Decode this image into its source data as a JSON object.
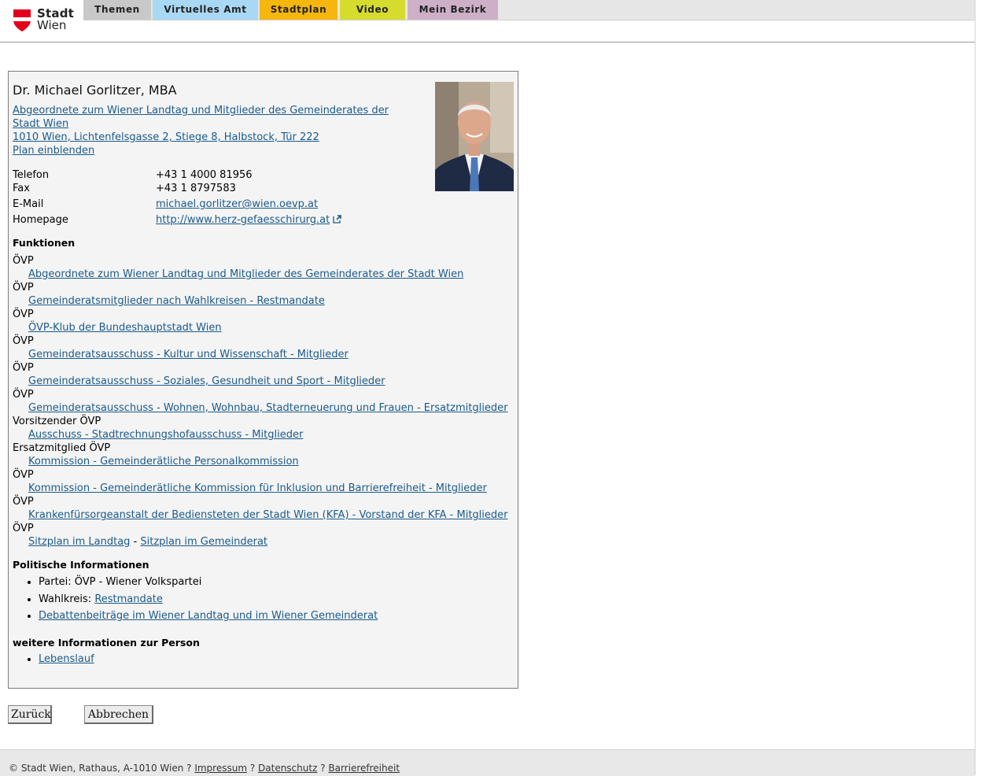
{
  "logo": {
    "line1": "Stadt",
    "line2": "Wien"
  },
  "nav": {
    "tabs": [
      {
        "label": "Themen",
        "color": "#c8c8c8"
      },
      {
        "label": "Virtuelles Amt",
        "color": "#a9d8f4"
      },
      {
        "label": "Stadtplan",
        "color": "#f5b70d"
      },
      {
        "label": "Video",
        "color": "#d6dc2e"
      },
      {
        "label": "Mein Bezirk",
        "color": "#cdb0c8"
      }
    ]
  },
  "person": {
    "name": "Dr. Michael Gorlitzer, MBA",
    "role_link_line1": "Abgeordnete zum Wiener Landtag und Mitglieder des Gemeinderates der",
    "role_link_line2": "Stadt Wien ",
    "address_link": "1010 Wien, Lichtenfelsgasse 2, Stiege 8, Halbstock, Tür 222",
    "plan_link": "Plan einblenden"
  },
  "contact": {
    "phone_label": "Telefon",
    "phone": "+43 1 4000 81956",
    "fax_label": "Fax",
    "fax": "+43 1 8797583",
    "email_label": "E-Mail",
    "email": "michael.gorlitzer@wien.oevp.at",
    "homepage_label": "Homepage",
    "homepage": "http://www.herz-gefaesschirurg.at"
  },
  "functions": {
    "title": "Funktionen",
    "items": [
      {
        "party": "ÖVP",
        "link": "Abgeordnete zum Wiener Landtag und Mitglieder des Gemeinderates der Stadt Wien"
      },
      {
        "party": "ÖVP",
        "link": "Gemeinderatsmitglieder nach Wahlkreisen - Restmandate"
      },
      {
        "party": "ÖVP",
        "link": "ÖVP-Klub der Bundeshauptstadt Wien"
      },
      {
        "party": "ÖVP",
        "link": "Gemeinderatsausschuss - Kultur und Wissenschaft - Mitglieder"
      },
      {
        "party": "ÖVP",
        "link": "Gemeinderatsausschuss - Soziales, Gesundheit und Sport - Mitglieder"
      },
      {
        "party": "ÖVP",
        "link": "Gemeinderatsausschuss - Wohnen, Wohnbau, Stadterneuerung und Frauen - Ersatzmitglieder"
      },
      {
        "party": "Vorsitzender ÖVP",
        "link": "Ausschuss - Stadtrechnungshofausschuss - Mitglieder"
      },
      {
        "party": "Ersatzmitglied ÖVP",
        "link": "Kommission - Gemeinderätliche Personalkommission"
      },
      {
        "party": "ÖVP",
        "link": "Kommission - Gemeinderätliche Kommission für Inklusion und Barrierefreiheit - Mitglieder"
      },
      {
        "party": "ÖVP",
        "link": "Krankenfürsorgeanstalt der Bediensteten der Stadt Wien (KFA) - Vorstand der KFA - Mitglieder"
      }
    ],
    "last_party": "ÖVP",
    "seat_landtag": "Sitzplan im Landtag",
    "seat_sep": " - ",
    "seat_gemeinderat": "Sitzplan im Gemeinderat"
  },
  "political": {
    "title": "Politische Informationen",
    "party": "Partei: ÖVP - Wiener Volkspartei",
    "district_label": "Wahlkreis: ",
    "district_link": "Restmandate",
    "debates_link": "Debattenbeiträge im Wiener Landtag und im Wiener Gemeinderat"
  },
  "more": {
    "title": "weitere Informationen zur Person",
    "cv_link": "Lebenslauf"
  },
  "buttons": {
    "back": "Zurück",
    "cancel": "Abbrechen"
  },
  "footer": {
    "copyright": "© Stadt Wien, Rathaus, A-1010 Wien ? ",
    "impressum": "Impressum",
    "sep1": " ? ",
    "datenschutz": "Datenschutz",
    "sep2": " ? ",
    "barrierefreiheit": "Barrierefreiheit"
  }
}
